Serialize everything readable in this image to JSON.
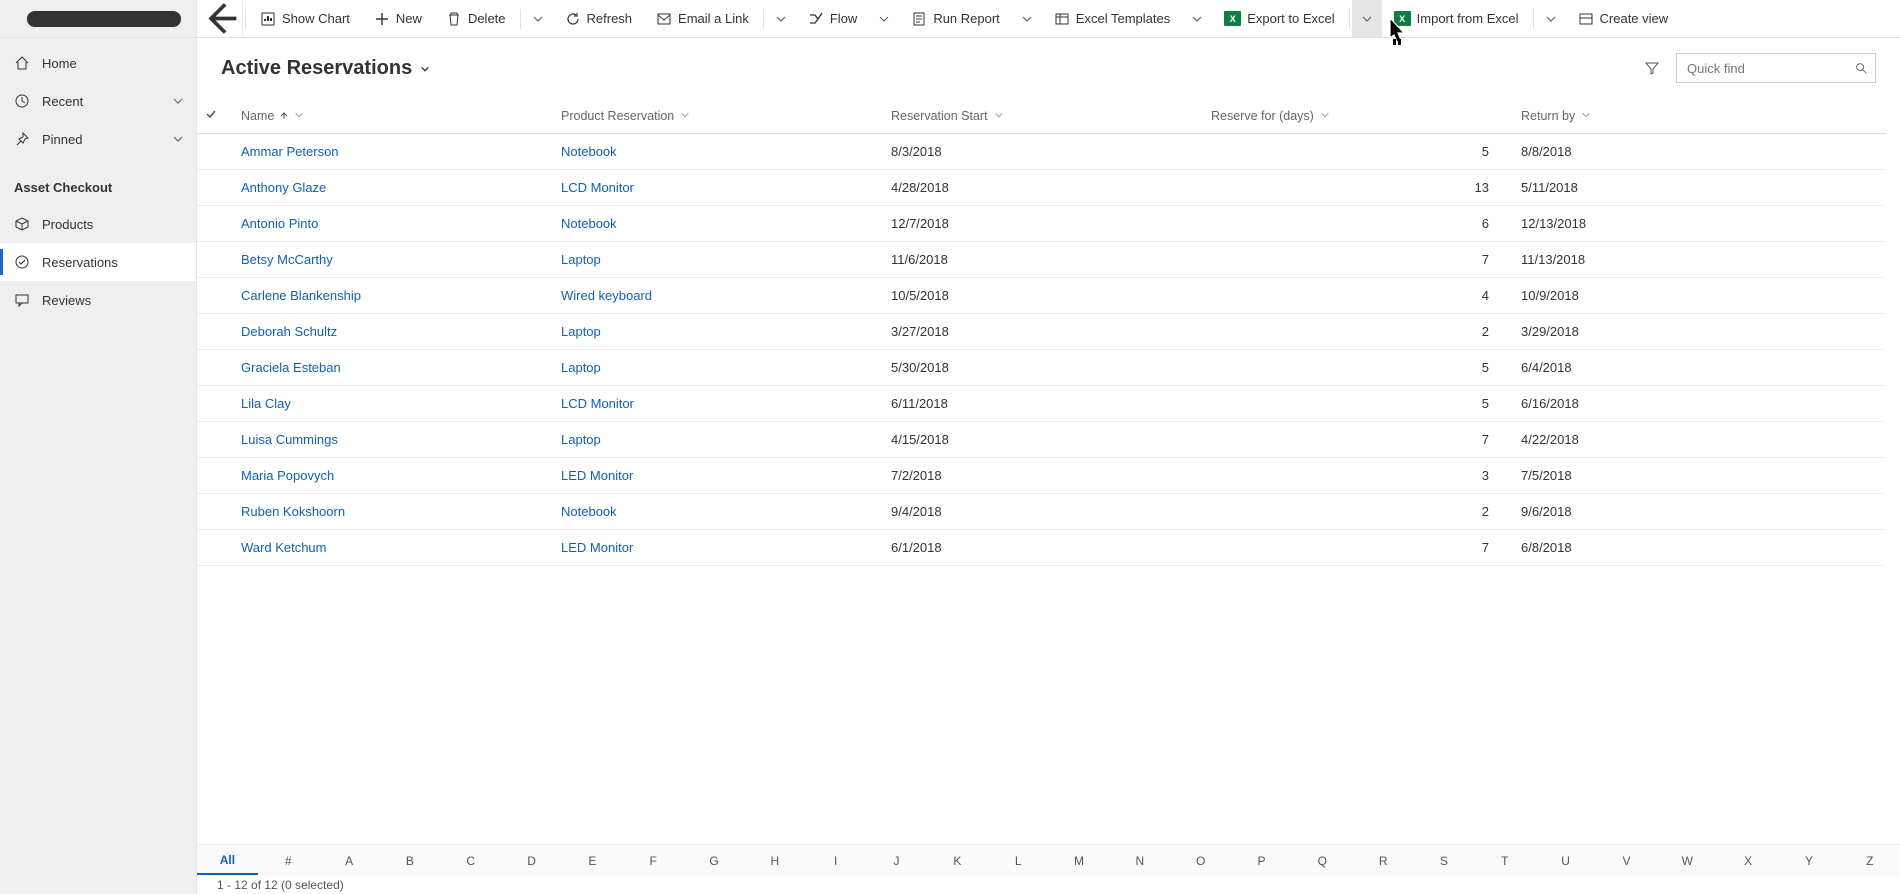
{
  "commands": {
    "show_chart": "Show Chart",
    "new": "New",
    "delete": "Delete",
    "refresh": "Refresh",
    "email_link": "Email a Link",
    "flow": "Flow",
    "run_report": "Run Report",
    "excel_templates": "Excel Templates",
    "export_excel": "Export to Excel",
    "import_excel": "Import from Excel",
    "create_view": "Create view"
  },
  "nav": {
    "home": "Home",
    "recent": "Recent",
    "pinned": "Pinned",
    "section": "Asset Checkout",
    "products": "Products",
    "reservations": "Reservations",
    "reviews": "Reviews"
  },
  "view": {
    "title": "Active Reservations",
    "quickfind_placeholder": "Quick find"
  },
  "columns": {
    "name": "Name",
    "product": "Product Reservation",
    "start": "Reservation Start",
    "days": "Reserve for (days)",
    "returnby": "Return by"
  },
  "rows": [
    {
      "name": "Ammar Peterson",
      "product": "Notebook",
      "start": "8/3/2018",
      "days": "5",
      "returnby": "8/8/2018"
    },
    {
      "name": "Anthony Glaze",
      "product": "LCD Monitor",
      "start": "4/28/2018",
      "days": "13",
      "returnby": "5/11/2018"
    },
    {
      "name": "Antonio Pinto",
      "product": "Notebook",
      "start": "12/7/2018",
      "days": "6",
      "returnby": "12/13/2018"
    },
    {
      "name": "Betsy McCarthy",
      "product": "Laptop",
      "start": "11/6/2018",
      "days": "7",
      "returnby": "11/13/2018"
    },
    {
      "name": "Carlene Blankenship",
      "product": "Wired keyboard",
      "start": "10/5/2018",
      "days": "4",
      "returnby": "10/9/2018"
    },
    {
      "name": "Deborah Schultz",
      "product": "Laptop",
      "start": "3/27/2018",
      "days": "2",
      "returnby": "3/29/2018"
    },
    {
      "name": "Graciela Esteban",
      "product": "Laptop",
      "start": "5/30/2018",
      "days": "5",
      "returnby": "6/4/2018"
    },
    {
      "name": "Lila Clay",
      "product": "LCD Monitor",
      "start": "6/11/2018",
      "days": "5",
      "returnby": "6/16/2018"
    },
    {
      "name": "Luisa Cummings",
      "product": "Laptop",
      "start": "4/15/2018",
      "days": "7",
      "returnby": "4/22/2018"
    },
    {
      "name": "Maria Popovych",
      "product": "LED Monitor",
      "start": "7/2/2018",
      "days": "3",
      "returnby": "7/5/2018"
    },
    {
      "name": "Ruben Kokshoorn",
      "product": "Notebook",
      "start": "9/4/2018",
      "days": "2",
      "returnby": "9/6/2018"
    },
    {
      "name": "Ward Ketchum",
      "product": "LED Monitor",
      "start": "6/1/2018",
      "days": "7",
      "returnby": "6/8/2018"
    }
  ],
  "alpha": [
    "All",
    "#",
    "A",
    "B",
    "C",
    "D",
    "E",
    "F",
    "G",
    "H",
    "I",
    "J",
    "K",
    "L",
    "M",
    "N",
    "O",
    "P",
    "Q",
    "R",
    "S",
    "T",
    "U",
    "V",
    "W",
    "X",
    "Y",
    "Z"
  ],
  "footer": "1 - 12 of 12 (0 selected)"
}
